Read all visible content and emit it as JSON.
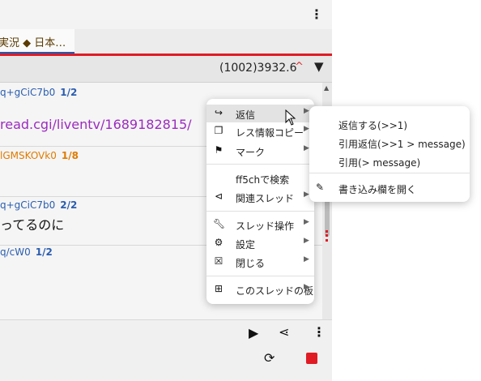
{
  "tab": {
    "label": "実況 ◆ 日本…"
  },
  "toolbar": {
    "count": "(1002)3932.6",
    "caret": "^",
    "filter_icon": "filter-icon"
  },
  "posts": [
    {
      "id": "q+gCiC7b0",
      "num": "1/2",
      "color": "blue"
    },
    {
      "link": "read.cgi/liventv/1689182815/"
    },
    {
      "id": "lGMSKOVk0",
      "num": "1/8",
      "color": "orange"
    },
    {
      "id": "q+gCiC7b0",
      "num": "2/2",
      "color": "blue"
    },
    {
      "text": "ってるのに"
    },
    {
      "id": "q/cW0",
      "num": "1/2",
      "color": "blue"
    }
  ],
  "menu": {
    "items": [
      {
        "label": "返信",
        "icon": "reply-icon",
        "submenu": true,
        "highlighted": true
      },
      {
        "label": "レス情報コピー",
        "icon": "copy-icon",
        "submenu": true
      },
      {
        "label": "マーク",
        "icon": "flag-icon",
        "submenu": true
      },
      {
        "label": "ff5chで検索",
        "icon": ""
      },
      {
        "label": "関連スレッド",
        "icon": "share-icon",
        "submenu": true
      },
      {
        "label": "スレッド操作",
        "icon": "wrench-icon",
        "submenu": true
      },
      {
        "label": "設定",
        "icon": "gear-icon",
        "submenu": true
      },
      {
        "label": "閉じる",
        "icon": "close-box-icon",
        "submenu": true
      },
      {
        "label": "このスレッドの板",
        "icon": "tree-icon",
        "submenu": true
      }
    ]
  },
  "submenu": {
    "items": [
      {
        "label": "返信する(>>1)"
      },
      {
        "label": "引用返信(>>1 > message)"
      },
      {
        "label": "引用(> message)"
      },
      {
        "label": "書き込み欄を開く",
        "icon": "edit-icon"
      }
    ]
  },
  "bottombar": {
    "play_icon": "play-icon",
    "share_icon": "share-icon",
    "more_icon": "more-vert-icon",
    "refresh_icon": "refresh-icon",
    "stop_icon": "stop-icon"
  },
  "colors": {
    "accent_red": "#e01b24",
    "link_purple": "#9c2bbf",
    "id_blue": "#2a5db0",
    "id_orange": "#e07b00"
  }
}
